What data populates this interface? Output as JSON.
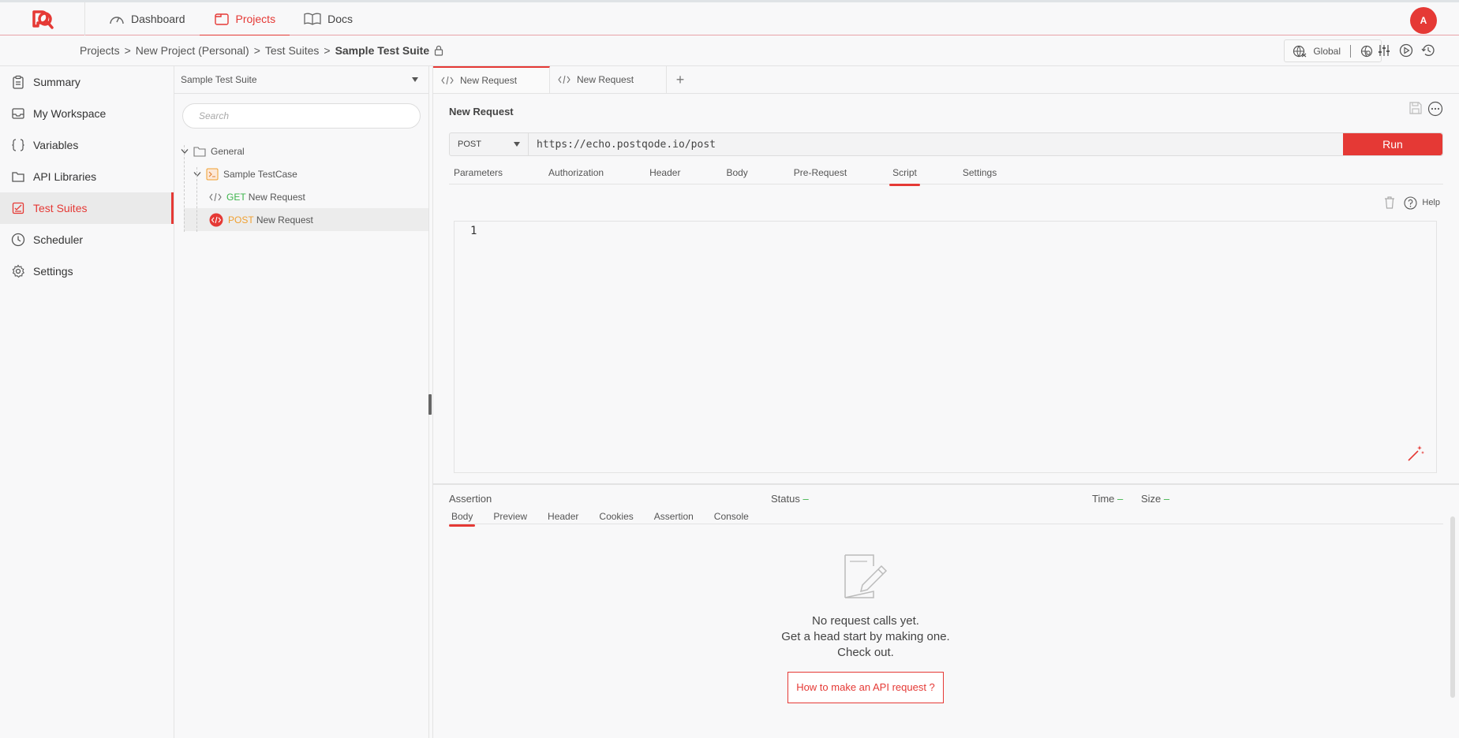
{
  "topbar": {
    "nav": [
      {
        "label": "Dashboard",
        "icon": "gauge-icon"
      },
      {
        "label": "Projects",
        "icon": "folder-icon",
        "active": true
      },
      {
        "label": "Docs",
        "icon": "book-icon"
      }
    ],
    "avatar": "A"
  },
  "breadcrumb": {
    "items": [
      "Projects",
      "New Project (Personal)",
      "Test Suites"
    ],
    "current": "Sample Test Suite",
    "env": "Global"
  },
  "sidebar": {
    "items": [
      {
        "label": "Summary"
      },
      {
        "label": "My Workspace"
      },
      {
        "label": "Variables"
      },
      {
        "label": "API Libraries"
      },
      {
        "label": "Test Suites",
        "active": true
      },
      {
        "label": "Scheduler"
      },
      {
        "label": "Settings"
      }
    ]
  },
  "tree": {
    "suite": "Sample Test Suite",
    "search_placeholder": "Search",
    "folder": "General",
    "testcase": "Sample TestCase",
    "requests": [
      {
        "method": "GET",
        "name": "New Request"
      },
      {
        "method": "POST",
        "name": "New Request"
      }
    ]
  },
  "main": {
    "tabs": [
      "New Request",
      "New Request"
    ],
    "title": "New Request",
    "method": "POST",
    "url": "https://echo.postqode.io/post",
    "run_label": "Run",
    "subtabs": [
      "Parameters",
      "Authorization",
      "Header",
      "Body",
      "Pre-Request",
      "Script",
      "Settings"
    ],
    "active_subtab": "Script",
    "help_label": "Help",
    "line_number": "1"
  },
  "response": {
    "assertion_label": "Assertion",
    "status_label": "Status",
    "time_label": "Time",
    "size_label": "Size",
    "dash": "–",
    "tabs": [
      "Body",
      "Preview",
      "Header",
      "Cookies",
      "Assertion",
      "Console"
    ],
    "empty_line1": "No request calls yet.",
    "empty_line2": "Get a head start by making one.",
    "empty_line3": "Check out.",
    "howto_label": "How to make an API request ?"
  },
  "colors": {
    "accent": "#e53935",
    "get": "#3cb44b",
    "post": "#f0a030"
  }
}
